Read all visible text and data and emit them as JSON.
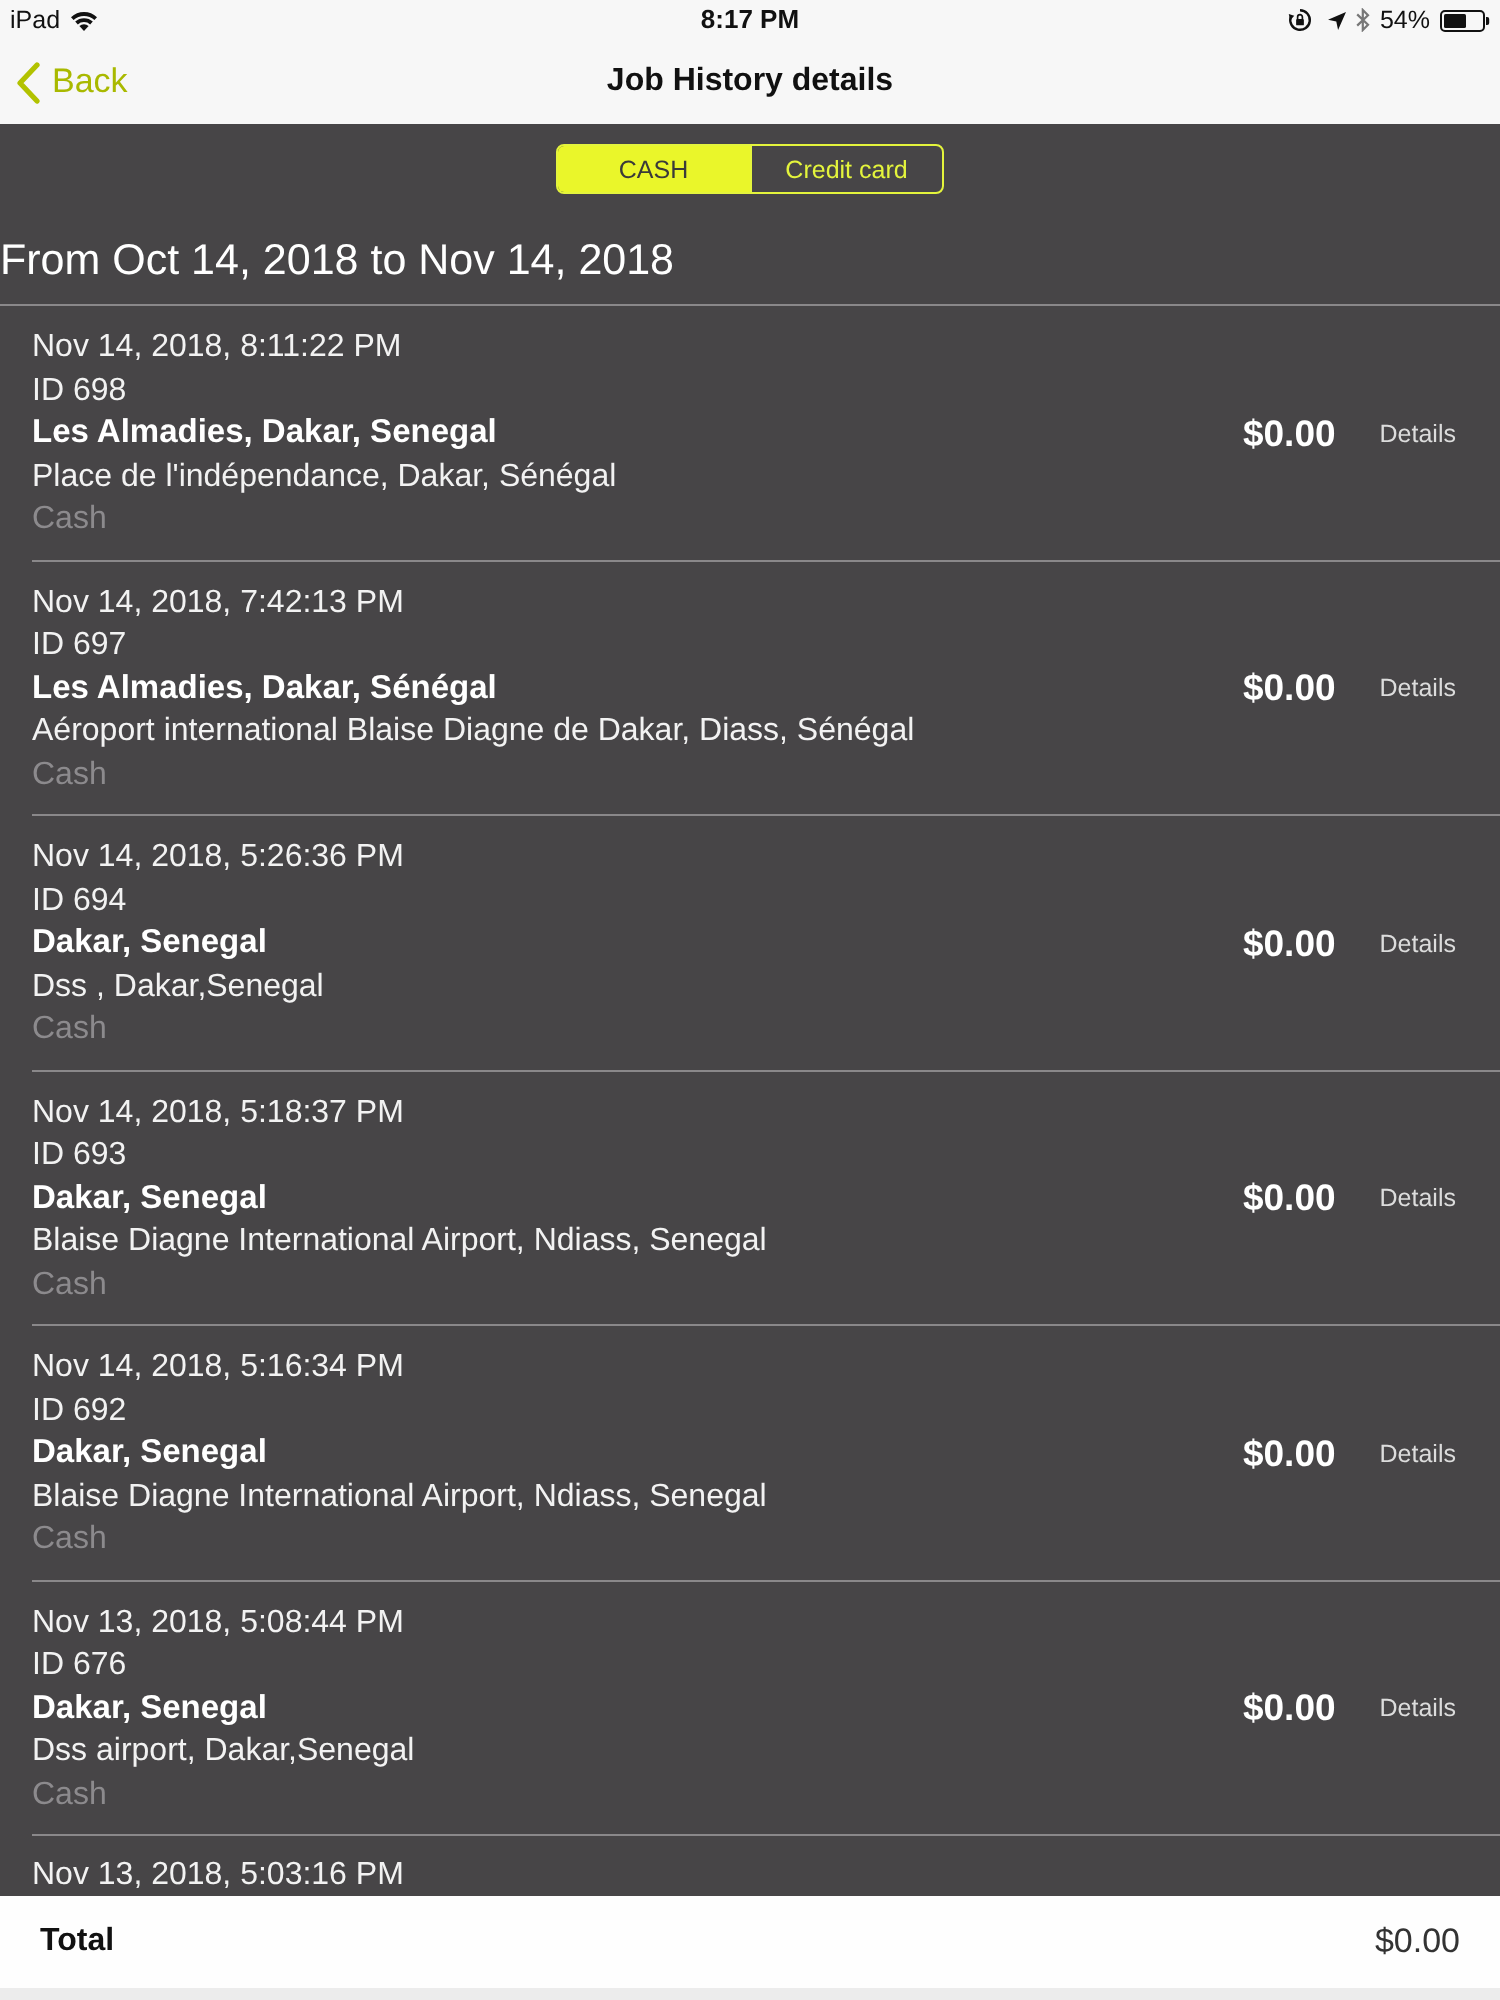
{
  "status_bar": {
    "device": "iPad",
    "time": "8:17 PM",
    "battery": "54%"
  },
  "nav": {
    "back": "Back",
    "title": "Job History details"
  },
  "segments": [
    {
      "label": "CASH",
      "selected": true
    },
    {
      "label": "Credit card",
      "selected": false
    }
  ],
  "range": "From Oct 14, 2018 to Nov 14, 2018",
  "jobs": [
    {
      "date": "Nov 14, 2018, 8:11:22 PM",
      "id": "ID 698",
      "pickup": "Les Almadies, Dakar, Senegal",
      "dropoff": "Place de l'indépendance, Dakar, Sénégal",
      "payment": "Cash",
      "amount": "$0.00",
      "action": "Details"
    },
    {
      "date": "Nov 14, 2018, 7:42:13 PM",
      "id": "ID 697",
      "pickup": "Les Almadies, Dakar, Sénégal",
      "dropoff": "Aéroport international Blaise Diagne de Dakar, Diass, Sénégal",
      "payment": "Cash",
      "amount": "$0.00",
      "action": "Details"
    },
    {
      "date": "Nov 14, 2018, 5:26:36 PM",
      "id": "ID 694",
      "pickup": "Dakar, Senegal",
      "dropoff": "Dss , Dakar,Senegal",
      "payment": "Cash",
      "amount": "$0.00",
      "action": "Details"
    },
    {
      "date": "Nov 14, 2018, 5:18:37 PM",
      "id": "ID 693",
      "pickup": "Dakar, Senegal",
      "dropoff": "Blaise Diagne International Airport, Ndiass, Senegal",
      "payment": "Cash",
      "amount": "$0.00",
      "action": "Details"
    },
    {
      "date": "Nov 14, 2018, 5:16:34 PM",
      "id": "ID 692",
      "pickup": "Dakar, Senegal",
      "dropoff": "Blaise Diagne International Airport, Ndiass, Senegal",
      "payment": "Cash",
      "amount": "$0.00",
      "action": "Details"
    },
    {
      "date": "Nov 13, 2018, 5:08:44 PM",
      "id": "ID 676",
      "pickup": "Dakar, Senegal",
      "dropoff": "Dss airport, Dakar,Senegal",
      "payment": "Cash",
      "amount": "$0.00",
      "action": "Details"
    }
  ],
  "cut_off_job": {
    "date": "Nov 13, 2018, 5:03:16 PM"
  },
  "total": {
    "label": "Total",
    "amount": "$0.00"
  }
}
